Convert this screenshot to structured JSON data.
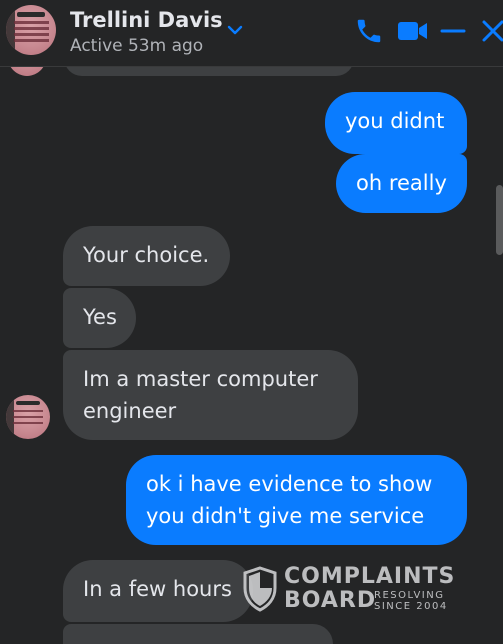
{
  "header": {
    "contact_name": "Trellini Davis",
    "status": "Active 53m ago",
    "icons": [
      "chevron-down-icon",
      "phone-icon",
      "video-camera-icon",
      "minimize-icon",
      "close-icon"
    ],
    "accent_color": "#0a7cff"
  },
  "messages": [
    {
      "direction": "outgoing",
      "text": "you didnt"
    },
    {
      "direction": "outgoing",
      "text": "oh really"
    },
    {
      "direction": "incoming",
      "text": "Your choice."
    },
    {
      "direction": "incoming",
      "text": "Yes"
    },
    {
      "direction": "incoming",
      "line1": "Im a master computer",
      "line2": "engineer"
    },
    {
      "direction": "outgoing",
      "line1": "ok i have evidence to show",
      "line2": "you didn't give me service"
    },
    {
      "direction": "incoming",
      "text": "In a few hours"
    }
  ],
  "watermark": {
    "line1": "COMPLAINTS",
    "line2": "BOARD",
    "tag1": "RESOLVING",
    "tag2": "SINCE 2004"
  },
  "colors": {
    "background": "#242526",
    "outgoing_bubble": "#0a7cff",
    "incoming_bubble": "#3e4042"
  }
}
